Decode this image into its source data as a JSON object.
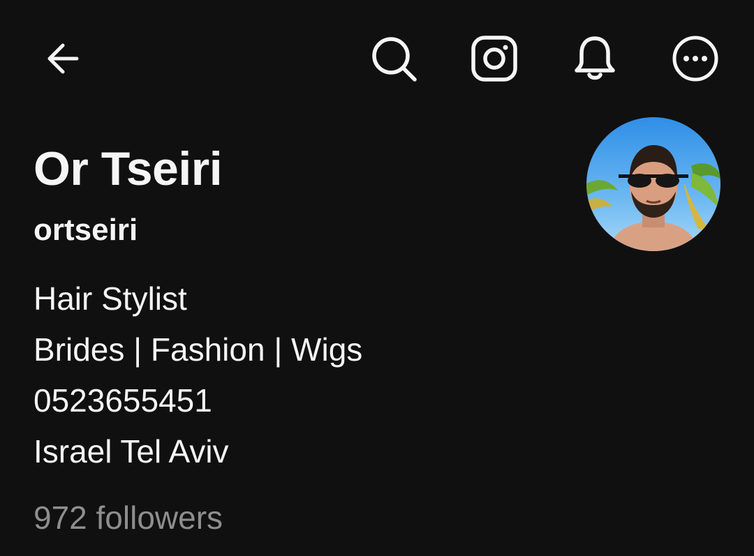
{
  "header": {
    "back_icon": "arrow-left-icon",
    "search_icon": "search-icon",
    "instagram_icon": "instagram-icon",
    "notifications_icon": "bell-icon",
    "more_icon": "more-horizontal-circle-icon"
  },
  "profile": {
    "display_name": "Or Tseiri",
    "username": "ortseiri",
    "bio_lines": [
      "Hair Stylist",
      "Brides | Fashion | Wigs",
      "0523655451",
      "Israel Tel Aviv"
    ],
    "followers_text": "972 followers"
  },
  "colors": {
    "background": "#101010",
    "primary_text": "#f5f5f5",
    "secondary_text": "#8e8e8e"
  }
}
